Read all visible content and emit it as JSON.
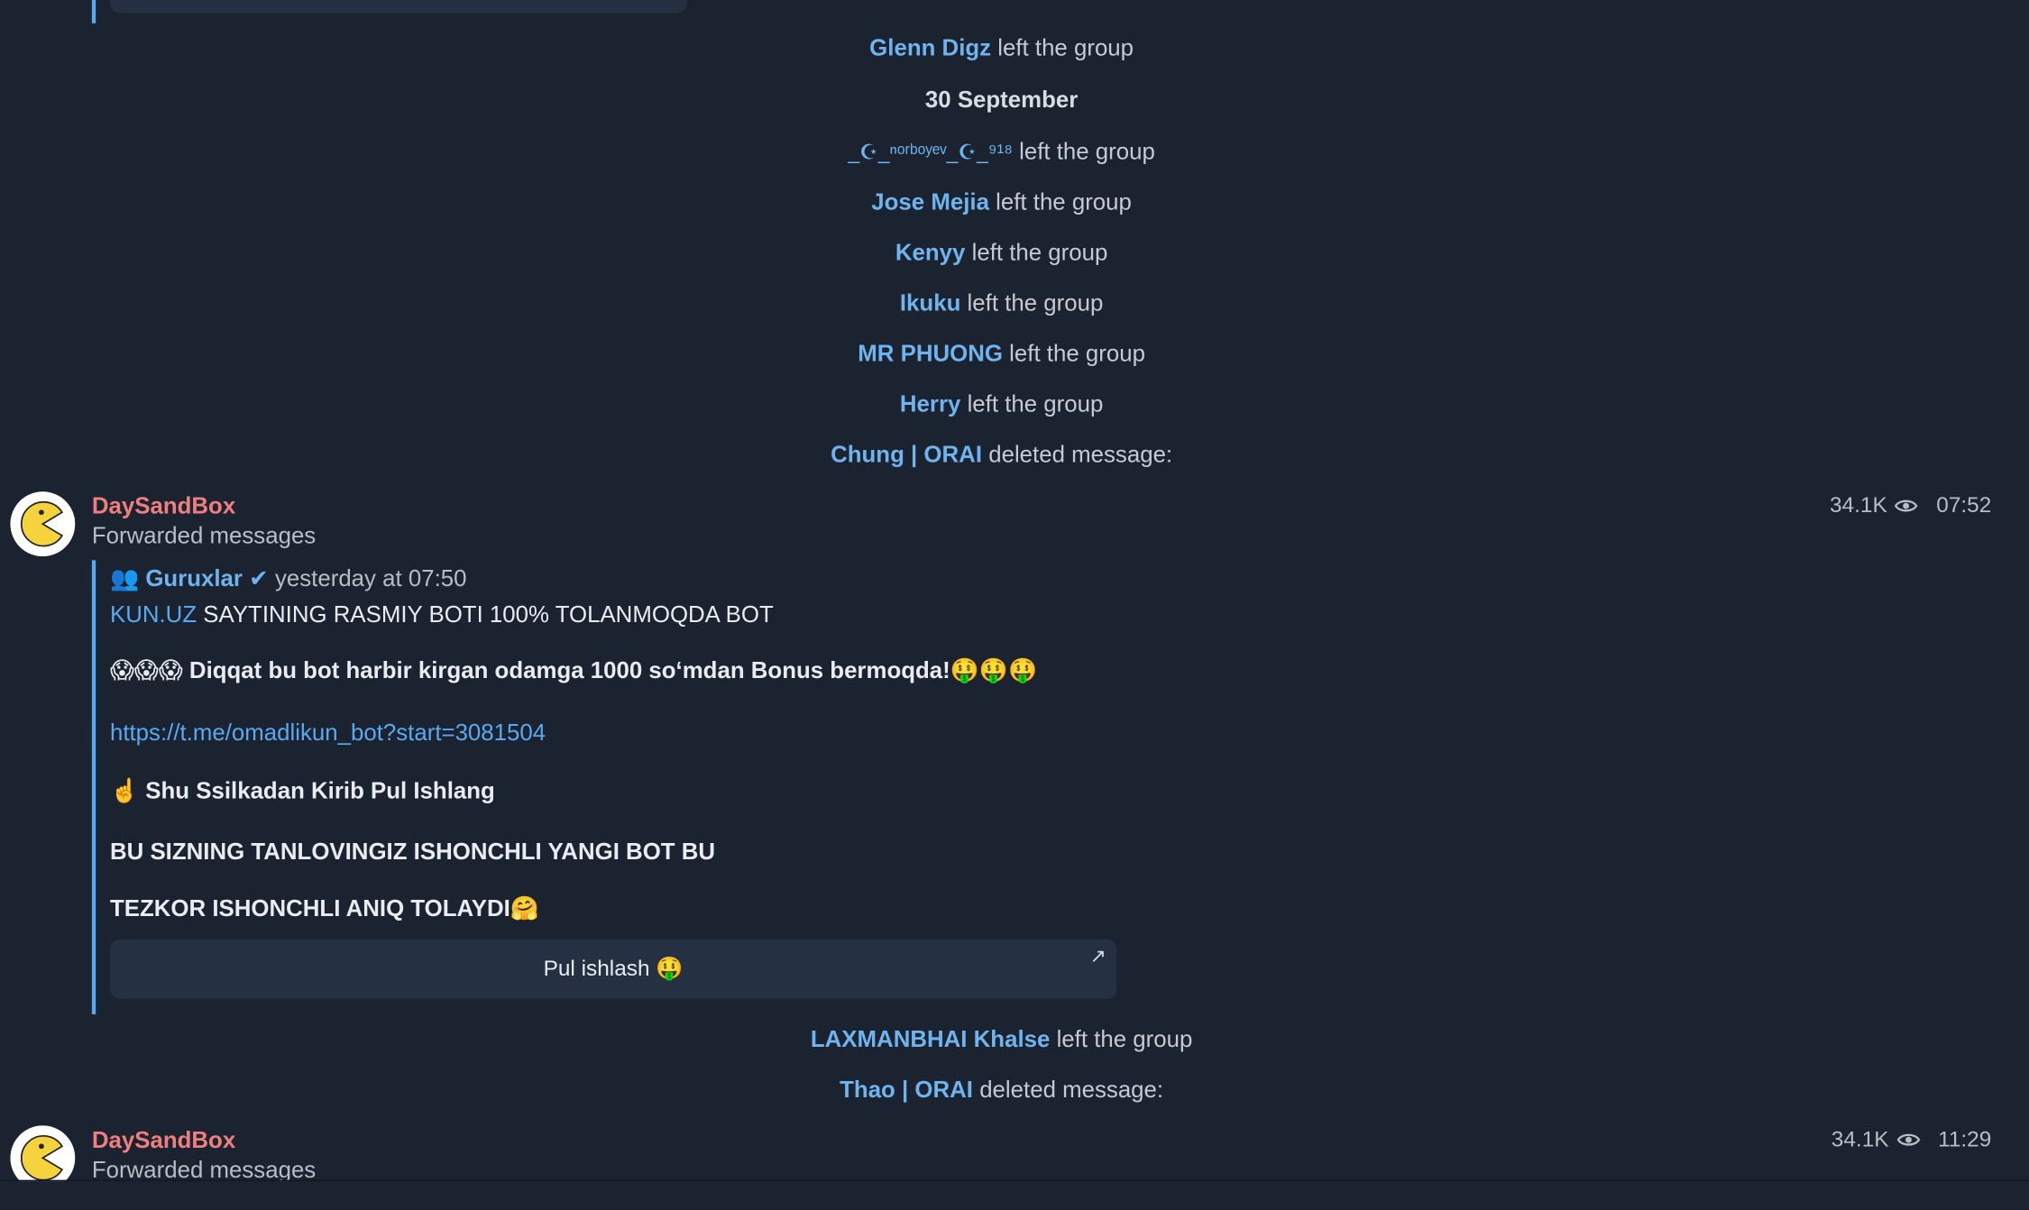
{
  "service_messages_top": [
    {
      "user": "Glenn Digz",
      "text": "left the group"
    },
    {
      "date": "30 September"
    },
    {
      "user": "_☪_ⁿᵒʳᵇᵒʸᵉᵛ_☪_⁹¹⁸",
      "text": "left the group"
    },
    {
      "user": "Jose Mejia",
      "text": "left the group"
    },
    {
      "user": "Kenyy",
      "text": "left the group"
    },
    {
      "user": "Ikuku",
      "text": "left the group"
    },
    {
      "user": "MR PHUONG",
      "text": "left the group"
    },
    {
      "user": "Herry",
      "text": "left the group"
    },
    {
      "user": "Chung | ORAI",
      "text": "deleted message:"
    }
  ],
  "message1": {
    "sender": "DaySandBox",
    "forwarded_label": "Forwarded messages",
    "views": "34.1K",
    "time": "07:52",
    "origin_icon": "👥",
    "origin_channel": "Guruxlar",
    "origin_check": "✔",
    "origin_time": "yesterday at 07:50",
    "line1_link": "KUN.UZ",
    "line1_text": " SAYTINING RASMIY BOTI 100% TOLANMOQDA BOT",
    "line2": "😱😱😱 Diqqat bu bot harbir kirgan odamga 1000 so‘mdan Bonus bermoqda!🤑🤑🤑",
    "line3_link": "https://t.me/omadlikun_bot?start=3081504",
    "line4": "☝️ Shu Ssilkadan Kirib Pul Ishlang",
    "line5": "BU SIZNING TANLOVINGIZ ISHONCHLI YANGI BOT BU",
    "line6": "TEZKOR ISHONCHLI ANIQ TOLAYDI🤗",
    "button_label": "Pul ishlash 🤑",
    "button_arrow": "↗"
  },
  "service_messages_bottom": [
    {
      "user": "LAXMANBHAI Khalse",
      "text": "left the group"
    },
    {
      "user": "Thao | ORAI",
      "text": "deleted message:"
    }
  ],
  "message2": {
    "sender": "DaySandBox",
    "forwarded_label": "Forwarded messages",
    "views": "34.1K",
    "time": "11:29"
  },
  "colors": {
    "background": "#1b2330",
    "link": "#5aa8f0",
    "username": "#6fb4ee",
    "sender": "#ef7f7f"
  }
}
